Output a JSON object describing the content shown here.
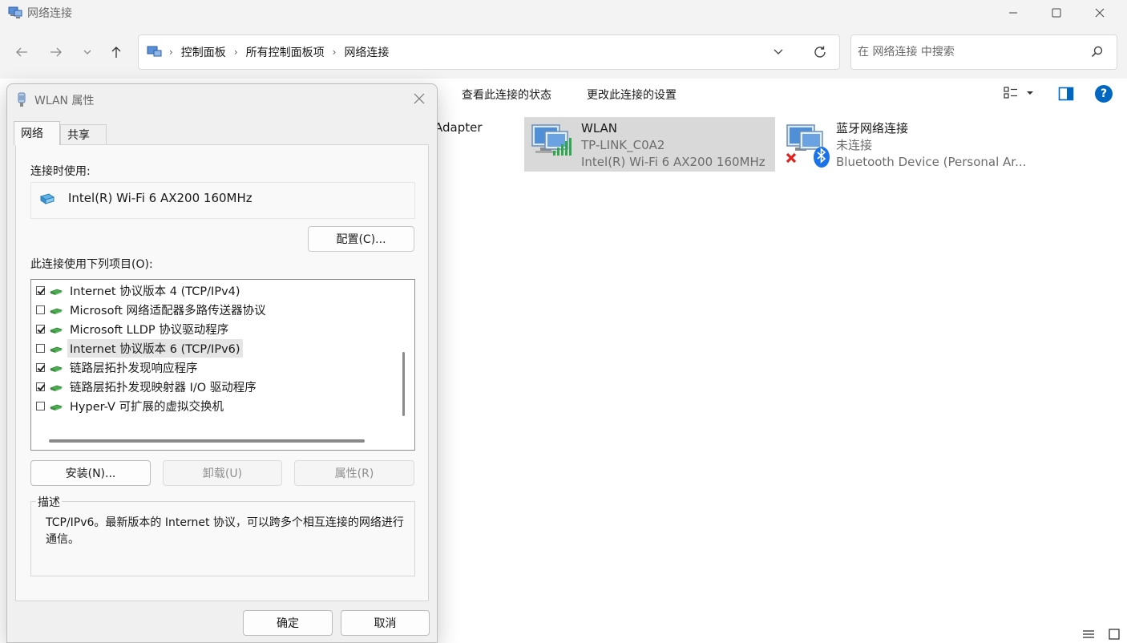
{
  "window": {
    "title": "网络连接",
    "controls": {
      "minimize": "—",
      "maximize": "☐",
      "close": "✕"
    }
  },
  "nav": {
    "back_icon": "arrow-left-icon",
    "forward_icon": "arrow-right-icon",
    "recent_icon": "chevron-down-icon",
    "up_icon": "arrow-up-icon"
  },
  "address": {
    "crumbs": [
      "控制面板",
      "所有控制面板项",
      "网络连接"
    ]
  },
  "search": {
    "placeholder": "在 网络连接 中搜索"
  },
  "commands": {
    "view_status": "查看此连接的状态",
    "change_settings": "更改此连接的设置"
  },
  "content": {
    "partial_adapter": "Adapter",
    "connections": [
      {
        "name": "WLAN",
        "status": "TP-LINK_C0A2",
        "device": "Intel(R) Wi-Fi 6 AX200 160MHz"
      },
      {
        "name": "蓝牙网络连接",
        "status": "未连接",
        "device": "Bluetooth Device (Personal Ar..."
      }
    ]
  },
  "dialog": {
    "title": "WLAN 属性",
    "tabs": [
      "网络",
      "共享"
    ],
    "connect_using_label": "连接时使用:",
    "adapter_name": "Intel(R) Wi-Fi 6 AX200 160MHz",
    "configure_button": "配置(C)...",
    "items_label": "此连接使用下列项目(O):",
    "items": [
      {
        "label": "Internet 协议版本 4 (TCP/IPv4)",
        "checked": true
      },
      {
        "label": "Microsoft 网络适配器多路传送器协议",
        "checked": false
      },
      {
        "label": "Microsoft LLDP 协议驱动程序",
        "checked": true
      },
      {
        "label": "Internet 协议版本 6 (TCP/IPv6)",
        "checked": false,
        "selected": true
      },
      {
        "label": "链路层拓扑发现响应程序",
        "checked": true
      },
      {
        "label": "链路层拓扑发现映射器 I/O 驱动程序",
        "checked": true
      },
      {
        "label": "Hyper-V 可扩展的虚拟交换机",
        "checked": false
      }
    ],
    "install_button": "安装(N)...",
    "uninstall_button": "卸载(U)",
    "properties_button": "属性(R)",
    "description_legend": "描述",
    "description_text": "TCP/IPv6。最新版本的 Internet 协议，可以跨多个相互连接的网络进行通信。",
    "ok_button": "确定",
    "cancel_button": "取消"
  },
  "colors": {
    "accent": "#0067c0",
    "selection": "#d9d9d9",
    "dialog_bg": "#f0f0f0"
  }
}
